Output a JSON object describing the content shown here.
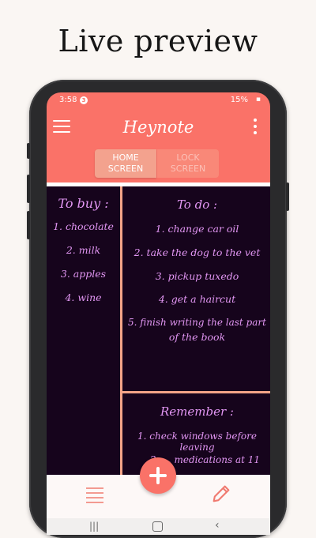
{
  "caption": "Live preview",
  "status_bar": {
    "time": "3:58",
    "notification_count": "3",
    "battery": "15%"
  },
  "app_bar": {
    "title": "Heynote"
  },
  "toggle": {
    "home": [
      "HOME",
      "SCREEN"
    ],
    "lock": [
      "LOCK",
      "SCREEN"
    ]
  },
  "notes": {
    "to_buy": {
      "heading": "To buy :",
      "items": [
        "1. chocolate",
        "2. milk",
        "3. apples",
        "4. wine"
      ]
    },
    "to_do": {
      "heading": "To do :",
      "items": [
        "1. change car oil",
        "2. take the dog to the vet",
        "3. pickup tuxedo",
        "4. get a haircut",
        "5. finish writing the last part",
        "of the book"
      ]
    },
    "remember": {
      "heading": "Remember :",
      "items": [
        "1. check windows before leaving",
        "2. ... medications at 11"
      ]
    }
  },
  "colors": {
    "accent": "#fa7268",
    "note_bg": "#16041c",
    "note_text": "#e296f3",
    "divider": "#f3a487"
  },
  "icons": {
    "menu": "hamburger-icon",
    "more": "more-vertical-icon",
    "fab": "plus-icon",
    "nav_left": "list-icon",
    "nav_right": "pencil-icon"
  }
}
